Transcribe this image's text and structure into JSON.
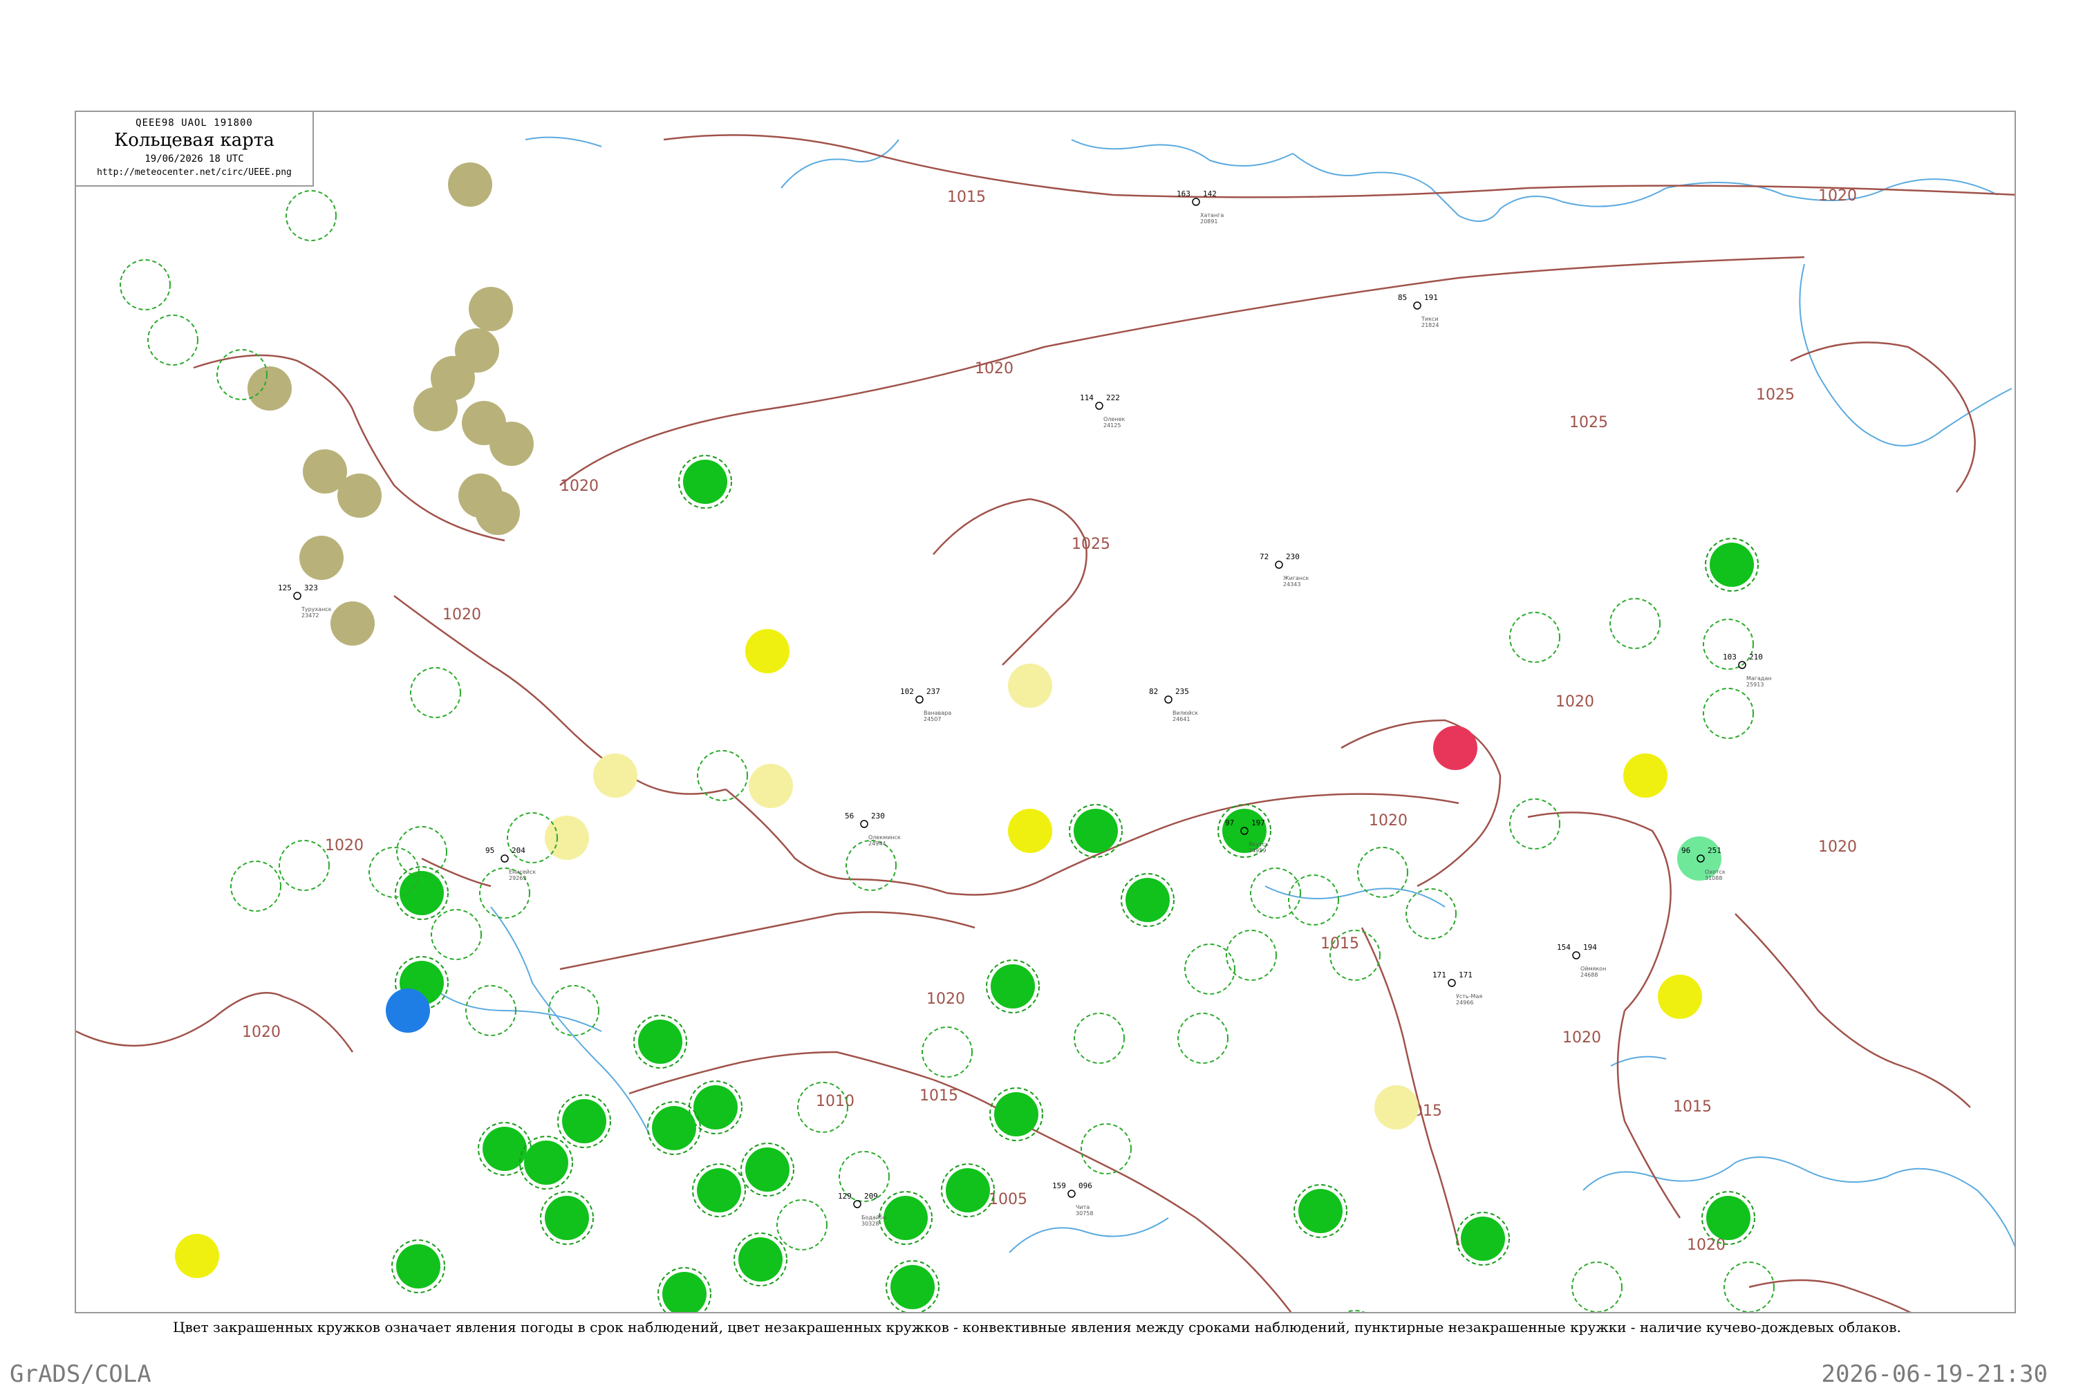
{
  "header": {
    "code_line": "QEEE98  UAOL  191800",
    "title": "Кольцевая карта",
    "date_line": "19/06/2026 18 UTC",
    "url": "http://meteocenter.net/circ/UEEE.png"
  },
  "caption": "Цвет закрашенных кружков означает явления погоды в срок наблюдений, цвет незакрашенных кружков - конвективные явления между сроками наблюдений, пунктирные незакрашенные кружки - наличие кучево-дождевых облаков.",
  "footer": {
    "left": "GrADS/COLA",
    "right": "2026-06-19-21:30"
  },
  "colors": {
    "isobar": "#a0524a",
    "water": "#5aaae0",
    "drizzle_fill": "#b8b27a",
    "rain_fill": "#11c21c",
    "shower_ring": "#1a9a1a",
    "fog_fill": "#f0f010",
    "haze_fill": "#f4f0a0",
    "snow_fill": "#1e7ee6",
    "thunder_fill": "#e8365a",
    "light_rain_fill": "#6fe89a"
  },
  "isobars": [
    {
      "label": "1015"
    },
    {
      "label": "1020"
    },
    {
      "label": "1025"
    },
    {
      "label": "1010"
    },
    {
      "label": "1005"
    }
  ],
  "stations": [
    {
      "name": "Жиганск",
      "id": "24343",
      "t": "72",
      "p": "230"
    },
    {
      "name": "Якутск",
      "id": "24959",
      "t": "97",
      "p": "197"
    },
    {
      "name": "Оленек",
      "id": "24125",
      "t": "114",
      "p": "222"
    },
    {
      "name": "Вилюйск",
      "id": "24641",
      "t": "82",
      "p": "235"
    },
    {
      "name": "Усть-Мая",
      "id": "24966",
      "t": "171",
      "p": "171"
    },
    {
      "name": "Тикси",
      "id": "21824",
      "t": "85",
      "p": "191"
    },
    {
      "name": "Туруханск",
      "id": "23472",
      "t": "125",
      "p": "323"
    },
    {
      "name": "Олекминск",
      "id": "24944",
      "t": "56",
      "p": "230"
    },
    {
      "name": "Ванавара",
      "id": "24507",
      "t": "102",
      "p": "237"
    },
    {
      "name": "Енисейск",
      "id": "29263",
      "t": "95",
      "p": "204"
    },
    {
      "name": "Бодайбо",
      "id": "30328",
      "t": "129",
      "p": "209"
    },
    {
      "name": "Чита",
      "id": "30758",
      "t": "159",
      "p": "096"
    },
    {
      "name": "Хатанга",
      "id": "20891",
      "t": "163",
      "p": "142"
    },
    {
      "name": "Оймякон",
      "id": "24688",
      "t": "154",
      "p": "194"
    },
    {
      "name": "Магадан",
      "id": "25913",
      "t": "103",
      "p": "210"
    },
    {
      "name": "Охотск",
      "id": "31088",
      "t": "96",
      "p": "251"
    }
  ]
}
